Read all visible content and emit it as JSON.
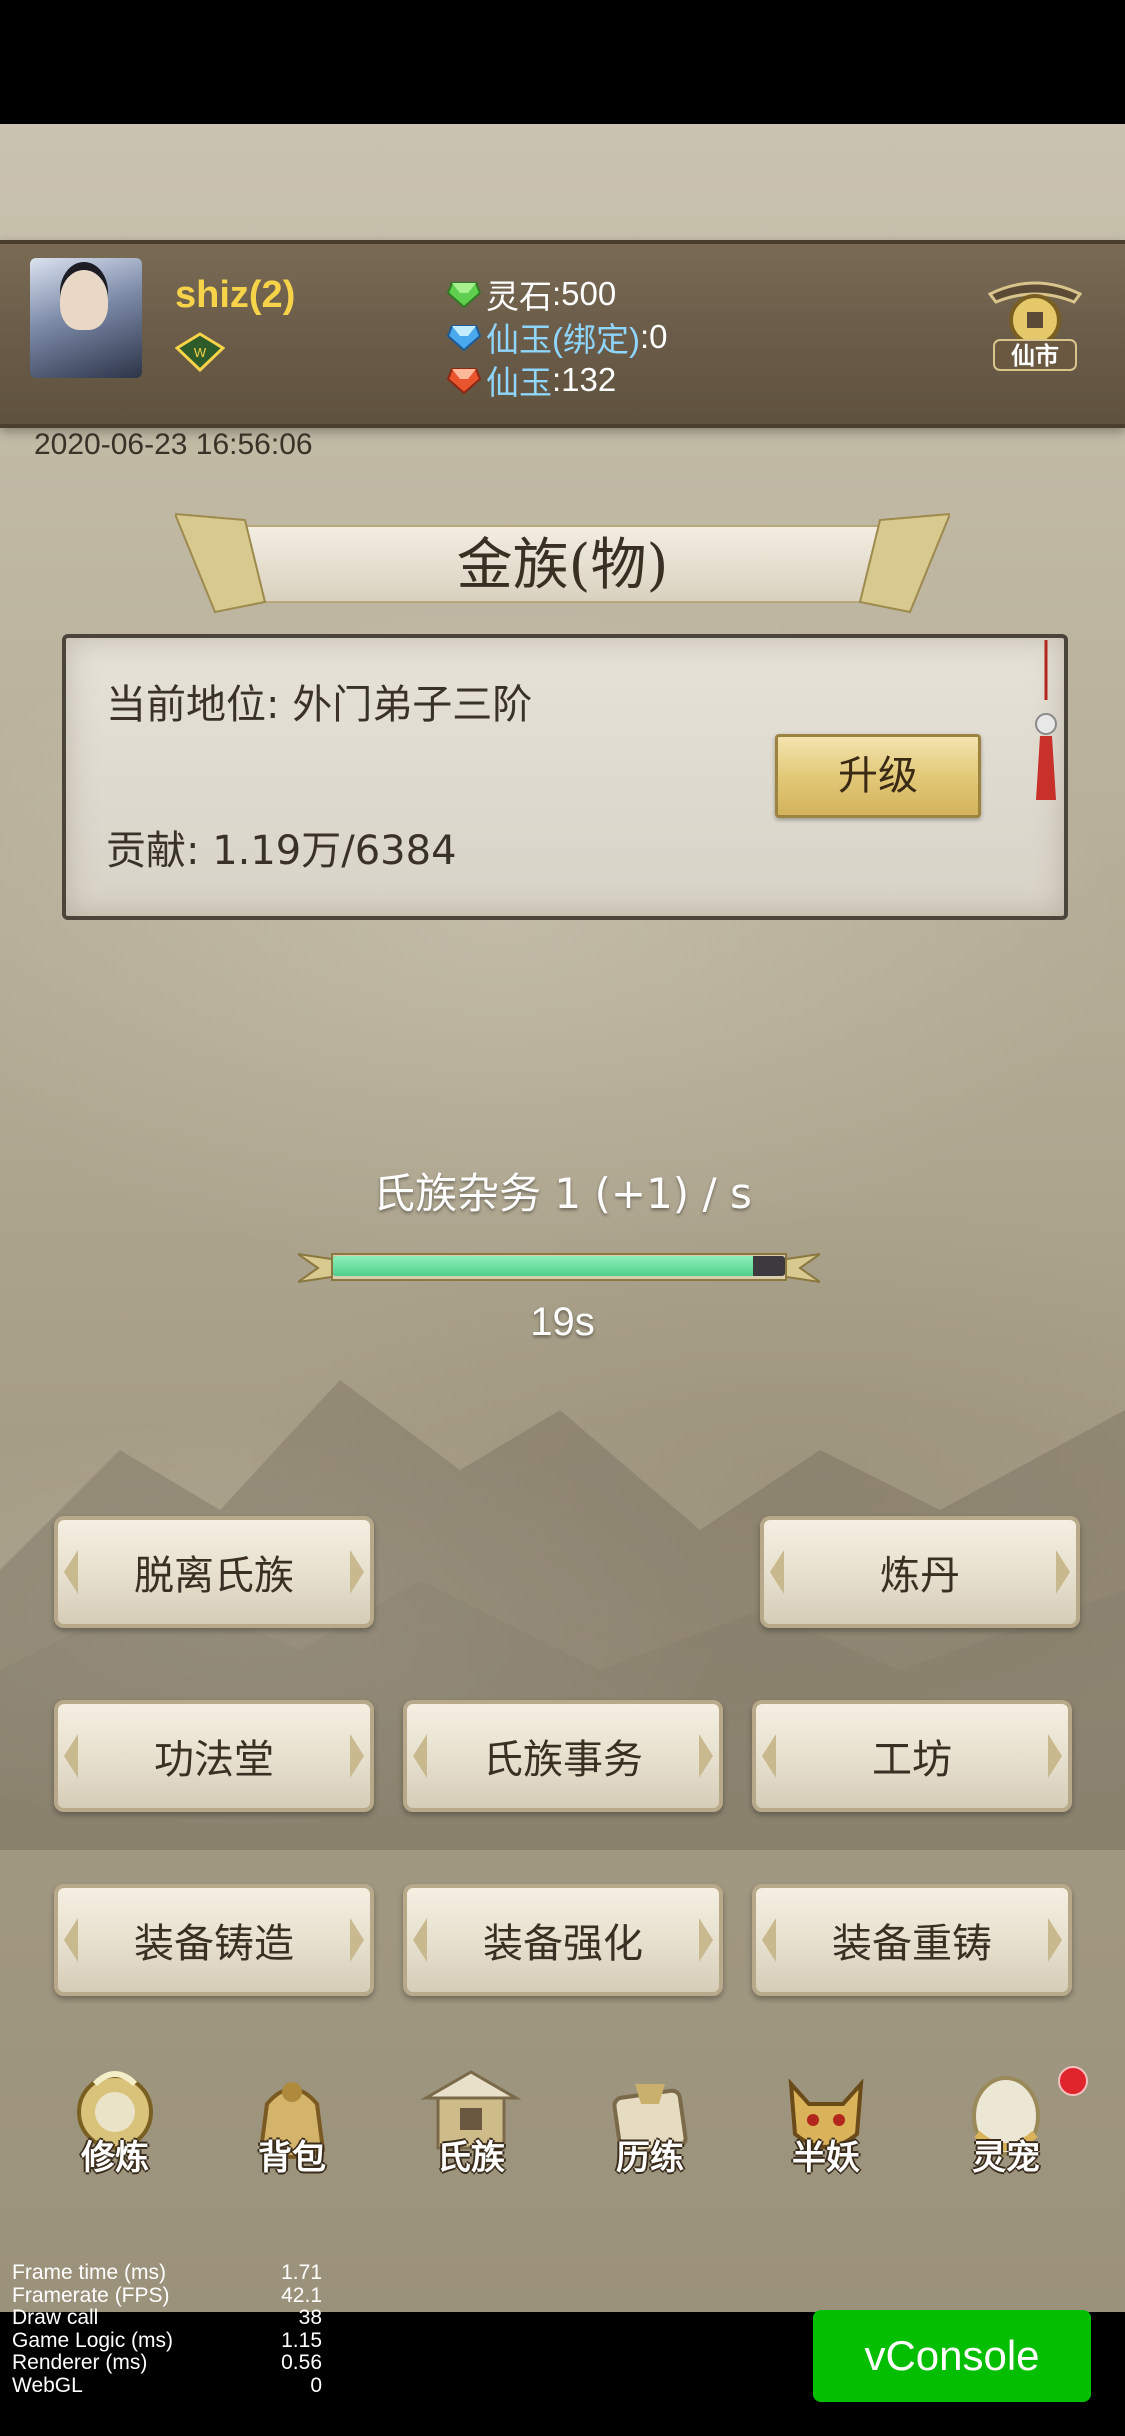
{
  "player": {
    "name": "shiz(2)",
    "vip_badge": "W"
  },
  "resources": [
    {
      "icon": "green-gem-icon",
      "label": "灵石",
      "value": "500",
      "sep": ": "
    },
    {
      "icon": "blue-gem-icon",
      "label": "仙玉(绑定)",
      "value": "0",
      "sep": ": "
    },
    {
      "icon": "red-gem-icon",
      "label": "仙玉",
      "value": "132",
      "sep": ": "
    }
  ],
  "market": {
    "label": "仙市"
  },
  "timestamp": "2020-06-23 16:56:06",
  "clan": {
    "title": "金族(物)",
    "position_text": "当前地位: 外门弟子三阶",
    "contribution_text": "贡献: 1.19万/6384",
    "upgrade_label": "升级"
  },
  "task": {
    "label": "氏族杂务 1 (+1) / s",
    "progress": 0.93,
    "timer": "19s"
  },
  "actions": {
    "leave_clan": "脱离氏族",
    "alchemy": "炼丹",
    "skill_hall": "功法堂",
    "clan_affairs": "氏族事务",
    "workshop": "工坊",
    "equip_forge": "装备铸造",
    "equip_enhance": "装备强化",
    "equip_reforge": "装备重铸"
  },
  "bottom_nav": [
    {
      "label": "修炼",
      "icon": "cultivate-icon"
    },
    {
      "label": "背包",
      "icon": "bag-icon"
    },
    {
      "label": "氏族",
      "icon": "clan-icon"
    },
    {
      "label": "历练",
      "icon": "adventure-icon"
    },
    {
      "label": "半妖",
      "icon": "demon-icon"
    },
    {
      "label": "灵宠",
      "icon": "pet-icon"
    }
  ],
  "debug": {
    "rows": [
      {
        "label": "Frame time (ms)",
        "value": "1.71"
      },
      {
        "label": "Framerate (FPS)",
        "value": "42.1"
      },
      {
        "label": "Draw call",
        "value": "38"
      },
      {
        "label": "Game Logic (ms)",
        "value": "1.15"
      },
      {
        "label": "Renderer (ms)",
        "value": "0.56"
      },
      {
        "label": "WebGL",
        "value": "0"
      }
    ]
  },
  "vconsole": {
    "label": "vConsole"
  },
  "colors": {
    "accent_gold": "#f7d34a",
    "progress_green": "#4fcf8c",
    "vconsole_green": "#04be02",
    "notify_red": "#e0242b"
  }
}
